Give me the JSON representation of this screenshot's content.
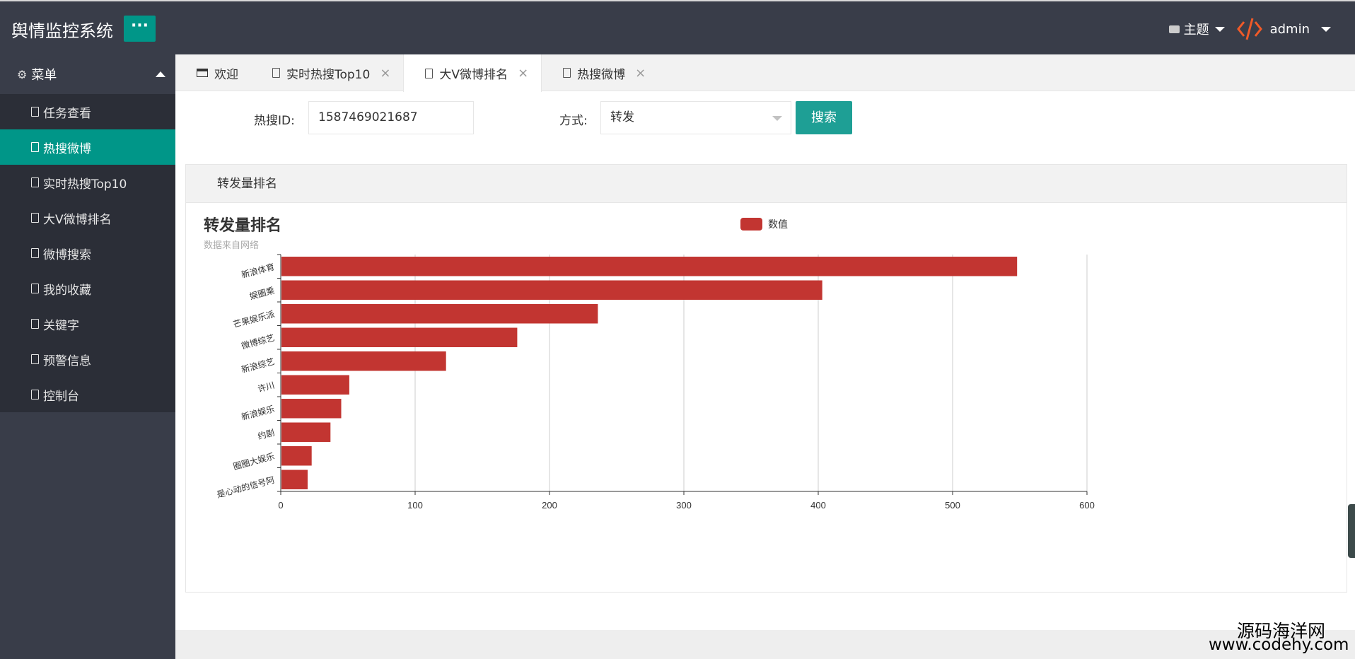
{
  "app": {
    "title": "舆情监控系统",
    "menu_toggle": "···"
  },
  "header_right": {
    "theme_label": "主题",
    "user_name": "admin"
  },
  "sidebar": {
    "heading": "菜单",
    "items": [
      {
        "label": "任务查看",
        "active": false
      },
      {
        "label": "热搜微博",
        "active": true
      },
      {
        "label": "实时热搜Top10",
        "active": false
      },
      {
        "label": "大V微博排名",
        "active": false
      },
      {
        "label": "微博搜索",
        "active": false
      },
      {
        "label": "我的收藏",
        "active": false
      },
      {
        "label": "关键字",
        "active": false
      },
      {
        "label": "预警信息",
        "active": false
      },
      {
        "label": "控制台",
        "active": false
      }
    ]
  },
  "tabs": [
    {
      "label": "欢迎",
      "closable": false,
      "active": false
    },
    {
      "label": "实时热搜Top10",
      "closable": true,
      "active": false
    },
    {
      "label": "大V微博排名",
      "closable": true,
      "active": true
    },
    {
      "label": "热搜微博",
      "closable": true,
      "active": false
    }
  ],
  "tab_close": "×",
  "search": {
    "id_label": "热搜ID:",
    "id_value": "1587469021687",
    "mode_label": "方式:",
    "mode_value": "转发",
    "button_label": "搜索"
  },
  "card": {
    "header": "转发量排名"
  },
  "chart_data": {
    "type": "bar",
    "orientation": "horizontal",
    "title": "转发量排名",
    "subtitle": "数据来自网络",
    "legend": [
      "数值"
    ],
    "legend_position": "top-center",
    "categories": [
      "新浪体育",
      "娱圈乘",
      "芒果娱乐派",
      "微博综艺",
      "新浪综艺",
      "许川",
      "新浪娱乐",
      "约剧",
      "圈圈大娱乐",
      "是心动的信号阿"
    ],
    "series": [
      {
        "name": "数值",
        "values": [
          548,
          403,
          236,
          176,
          123,
          51,
          45,
          37,
          23,
          20
        ]
      }
    ],
    "xlim": [
      0,
      600
    ],
    "xticks": [
      0,
      100,
      200,
      300,
      400,
      500,
      600
    ],
    "grid": true,
    "bar_color": "#c23531"
  },
  "watermark": {
    "line1": "源码海洋网",
    "line2": "www.codehy.com"
  }
}
